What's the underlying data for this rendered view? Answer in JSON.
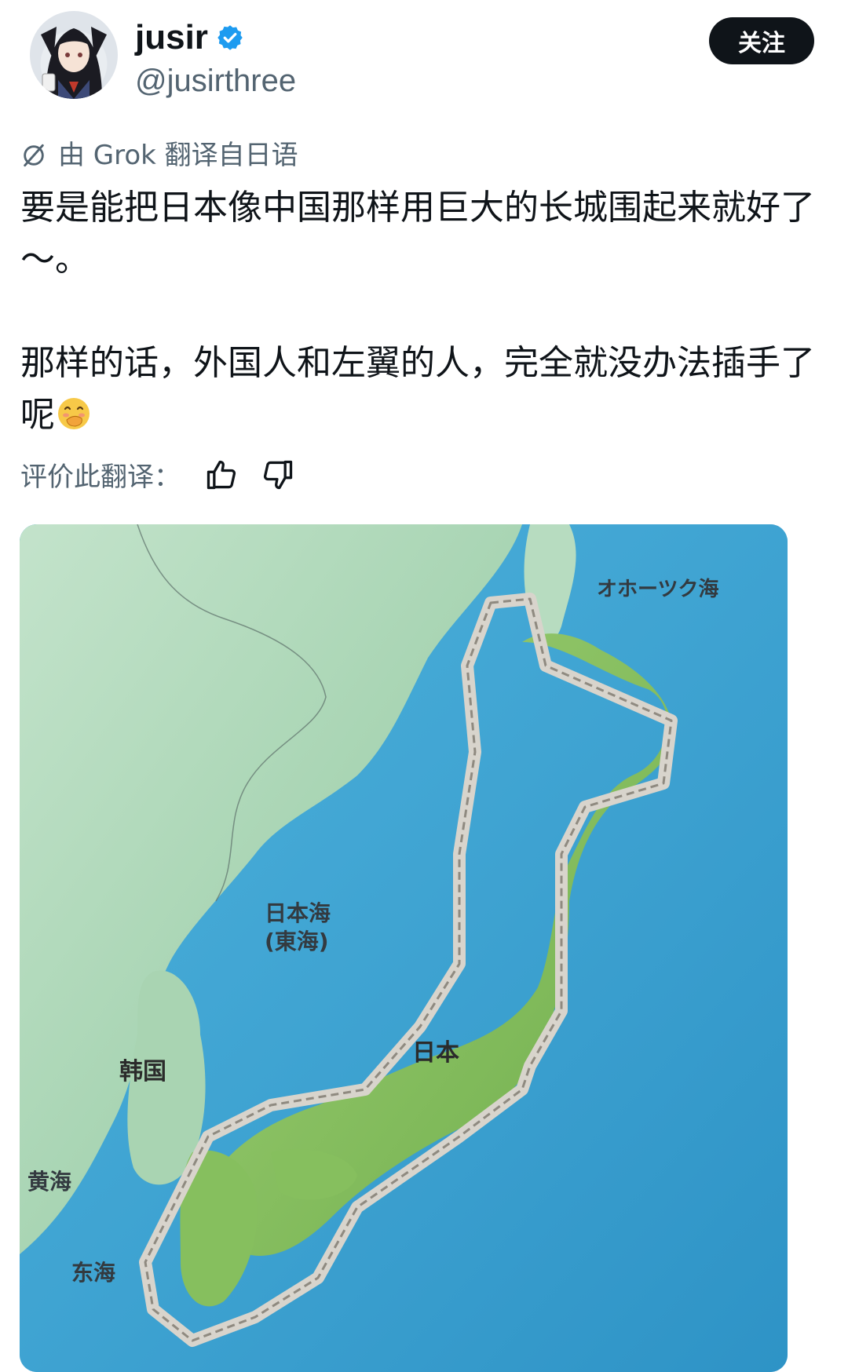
{
  "user": {
    "display_name": "jusir",
    "handle": "@jusirthree",
    "follow_label": "关注"
  },
  "translation": {
    "note": "由 Grok 翻译自日语",
    "rate_label": "评价此翻译："
  },
  "tweet": {
    "paragraph1": "要是能把日本像中国那样用巨大的长城围起来就好了～。",
    "paragraph2": "那样的话，外国人和左翼的人，完全就没办法插手了呢"
  },
  "map": {
    "labels": {
      "okhotsk": "オホーツク海",
      "sea_of_japan": "日本海",
      "east_sea": "(東海)",
      "japan": "日本",
      "korea": "韩国",
      "yellow_sea": "黄海",
      "east_china_sea": "东海"
    }
  },
  "colors": {
    "accent_verified": "#1d9bf0",
    "follow_bg": "#0f1419",
    "secondary_text": "#536471",
    "sea": "#3aa4d4",
    "land": "#a8d6b4"
  },
  "icons": {
    "verified": "verified-badge-icon",
    "translate": "grok-translate-icon",
    "thumbs_up": "thumbs-up-icon",
    "thumbs_down": "thumbs-down-icon",
    "emoji": "face-with-hand-over-mouth-emoji"
  }
}
